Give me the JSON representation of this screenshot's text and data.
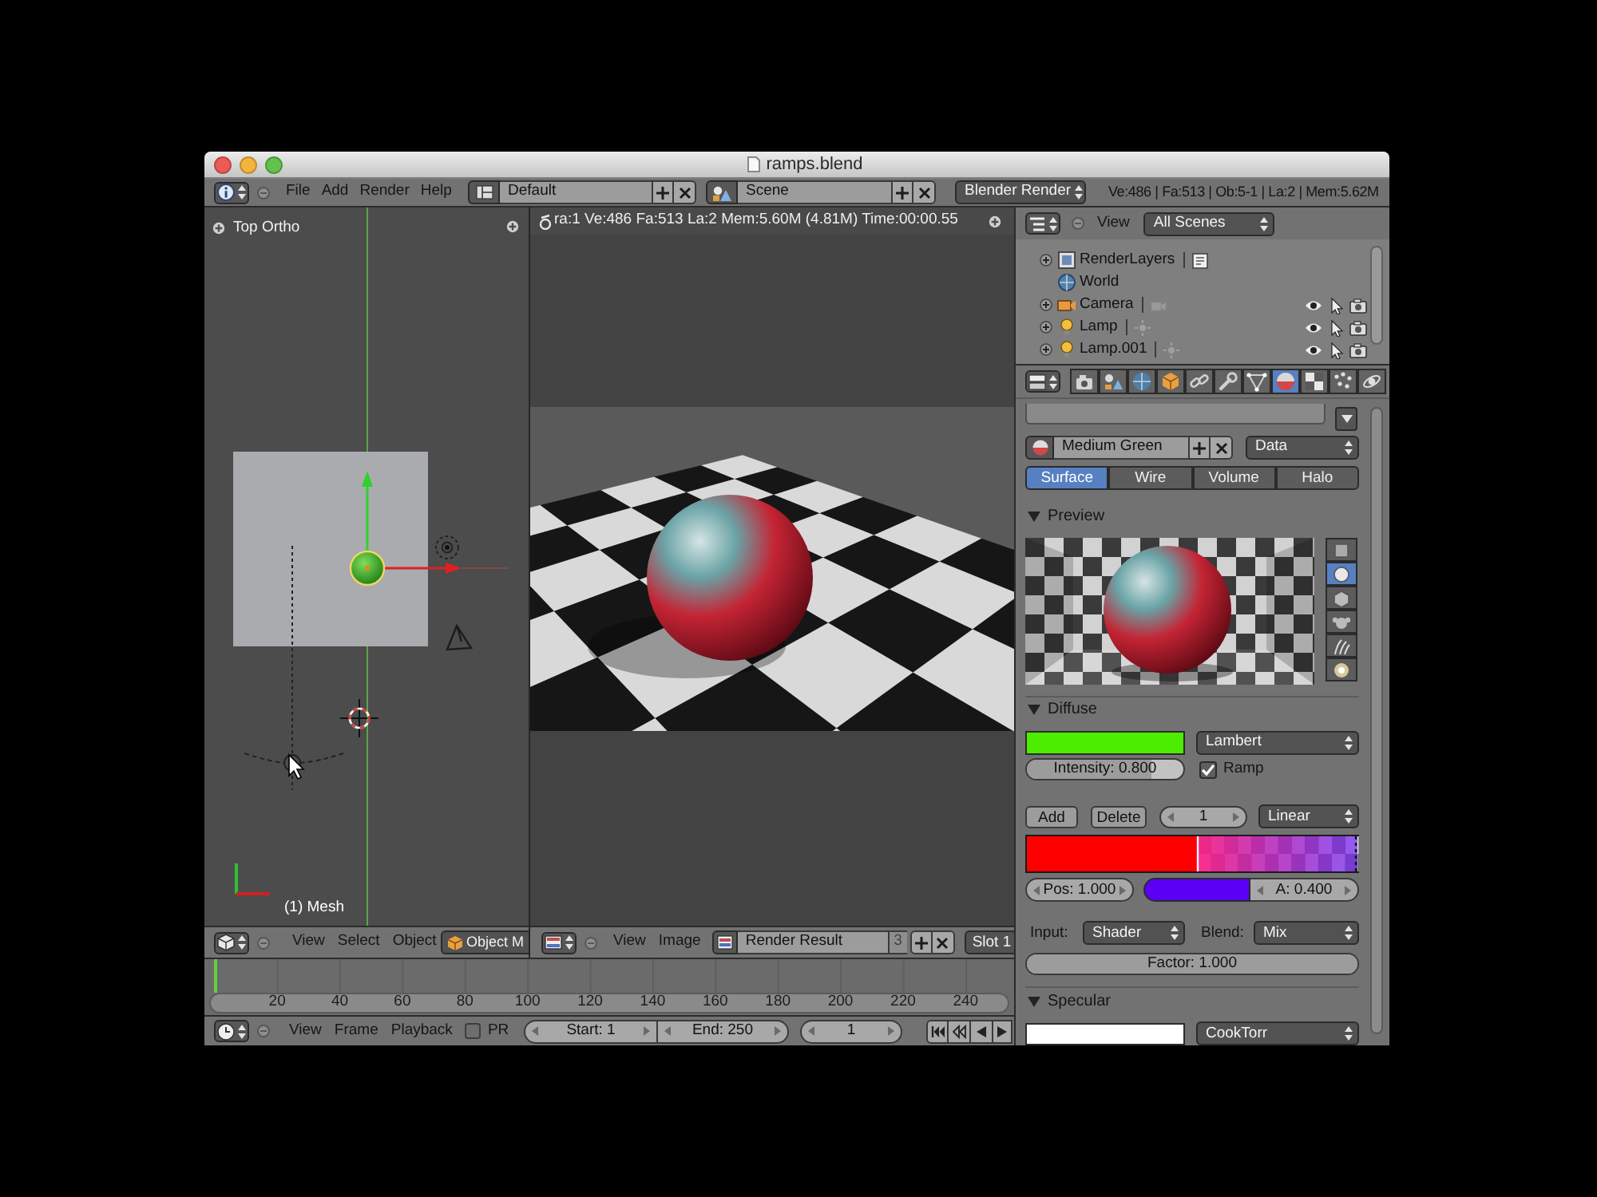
{
  "window": {
    "title": "ramps.blend"
  },
  "info_header": {
    "menus": [
      "File",
      "Add",
      "Render",
      "Help"
    ],
    "layout": "Default",
    "scene": "Scene",
    "engine": "Blender Render",
    "stats": "Ve:486 | Fa:513 | Ob:5-1 | La:2 | Mem:5.62M"
  },
  "viewport": {
    "view_name": "Top Ortho",
    "object_info": "(1) Mesh",
    "header": {
      "menus": [
        "View",
        "Select",
        "Object"
      ],
      "mode": "Object M"
    }
  },
  "image_editor": {
    "render_info": "ra:1 Ve:486 Fa:513 La:2 Mem:5.60M (4.81M) Time:00:00.55",
    "header": {
      "menus": [
        "View",
        "Image"
      ],
      "image": "Render Result",
      "users": "3",
      "slot": "Slot 1"
    }
  },
  "timeline": {
    "frame_labels": [
      "20",
      "40",
      "60",
      "80",
      "100",
      "120",
      "140",
      "160",
      "180",
      "200",
      "220",
      "240"
    ],
    "header": {
      "menus": [
        "View",
        "Frame",
        "Playback"
      ],
      "preview_range": {
        "label": "PR",
        "checked": false
      },
      "start": "Start: 1",
      "end": "End: 250",
      "current_frame": "1"
    }
  },
  "outliner": {
    "header": {
      "menu": "View",
      "filter": "All Scenes"
    },
    "items": [
      {
        "name": "RenderLayers",
        "kind": "renderlayers",
        "expanded": false
      },
      {
        "name": "World",
        "kind": "world"
      },
      {
        "name": "Camera",
        "kind": "camera",
        "expanded": false
      },
      {
        "name": "Lamp",
        "kind": "lamp",
        "expanded": false
      },
      {
        "name": "Lamp.001",
        "kind": "lamp",
        "expanded": false
      }
    ]
  },
  "properties": {
    "tabs": [
      {
        "kind": "render",
        "selected": false
      },
      {
        "kind": "scene",
        "selected": false
      },
      {
        "kind": "world",
        "selected": false
      },
      {
        "kind": "object",
        "selected": false
      },
      {
        "kind": "constraints",
        "selected": false
      },
      {
        "kind": "modifiers",
        "selected": false
      },
      {
        "kind": "data",
        "selected": false
      },
      {
        "kind": "material",
        "selected": true
      },
      {
        "kind": "texture",
        "selected": false
      },
      {
        "kind": "particles",
        "selected": false
      },
      {
        "kind": "physics",
        "selected": false
      }
    ],
    "material": {
      "name": "Medium Green",
      "link": "Data"
    },
    "material_tabs": [
      {
        "label": "Surface",
        "selected": true
      },
      {
        "label": "Wire",
        "selected": false
      },
      {
        "label": "Volume",
        "selected": false
      },
      {
        "label": "Halo",
        "selected": false
      }
    ],
    "preview": {
      "title": "Preview",
      "expanded": true,
      "shapes": [
        {
          "kind": "flat",
          "selected": false
        },
        {
          "kind": "sphere",
          "selected": true
        },
        {
          "kind": "cube",
          "selected": false
        },
        {
          "kind": "monkey",
          "selected": false
        },
        {
          "kind": "hair",
          "selected": false
        },
        {
          "kind": "sky",
          "selected": false
        }
      ]
    },
    "diffuse": {
      "title": "Diffuse",
      "expanded": true,
      "color": "#4ced00",
      "shader": "Lambert",
      "intensity": {
        "label": "Intensity: 0.800",
        "level": 0.8
      },
      "ramp": {
        "label": "Ramp",
        "checked": true
      },
      "ramp_editor": {
        "add": "Add",
        "delete": "Delete",
        "active_stop": "1",
        "interpolation": "Linear",
        "stop": {
          "position": "Pos: 1.000",
          "color": "#5b00f5",
          "alpha": "A: 0.400"
        },
        "input_label": "Input:",
        "input": "Shader",
        "blend_label": "Blend:",
        "blend": "Mix",
        "factor": {
          "label": "Factor: 1.000",
          "level": 1
        }
      }
    },
    "specular": {
      "title": "Specular",
      "expanded": true,
      "color": "#ffffff",
      "shader": "CookTorr"
    }
  }
}
